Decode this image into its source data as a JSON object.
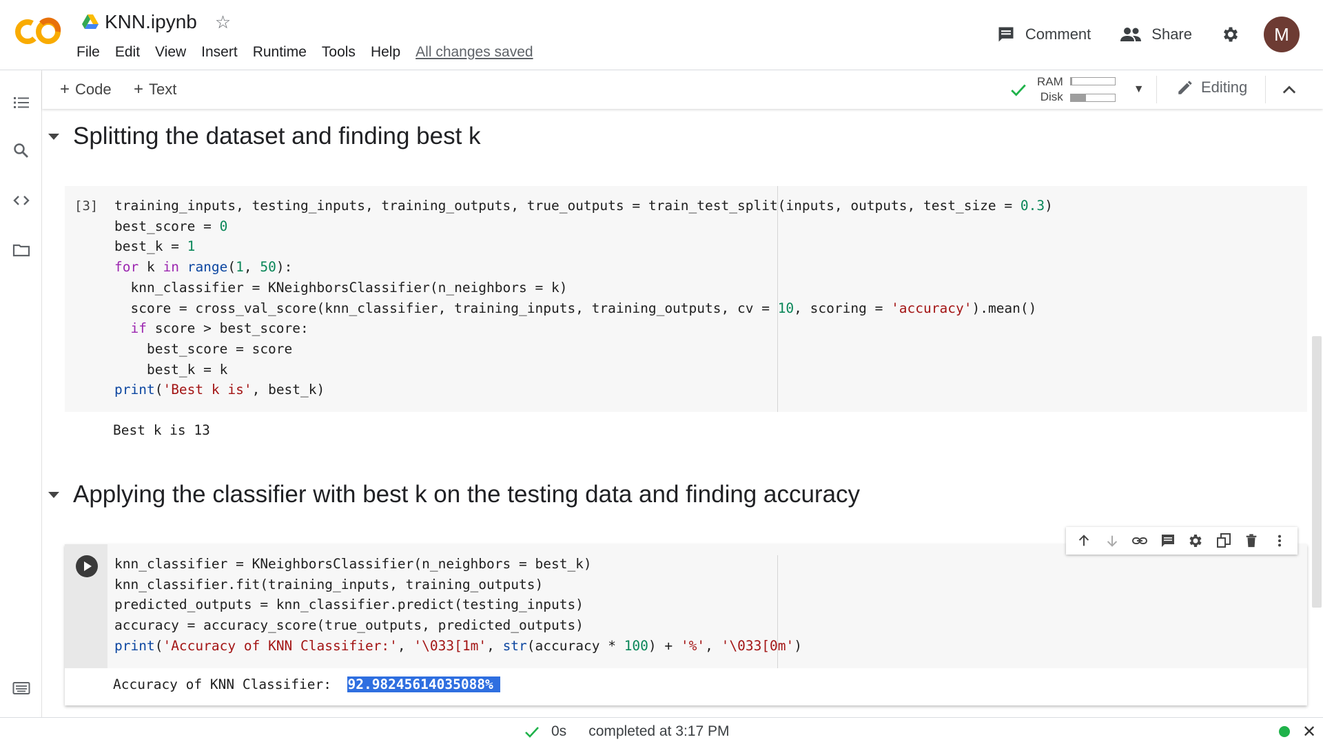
{
  "app": {
    "logo_text": "CO",
    "doc_title": "KNN.ipynb"
  },
  "menu": [
    "File",
    "Edit",
    "View",
    "Insert",
    "Runtime",
    "Tools",
    "Help"
  ],
  "save_status": "All changes saved",
  "header": {
    "comment_label": "Comment",
    "share_label": "Share",
    "avatar_initial": "M"
  },
  "toolbar": {
    "add_code_label": "Code",
    "add_text_label": "Text",
    "ram_label": "RAM",
    "disk_label": "Disk",
    "ram_usage": 0.04,
    "disk_usage": 0.35,
    "mode_label": "Editing"
  },
  "sections": [
    {
      "title": "Splitting the dataset and finding best k"
    },
    {
      "title": "Applying the classifier with best k on the testing data and finding accuracy"
    }
  ],
  "cells": [
    {
      "execution_count": "[3]",
      "code_lines": [
        "training_inputs, testing_inputs, training_outputs, true_outputs = train_test_split(inputs, outputs, test_size = 0.3)",
        "best_score = 0",
        "best_k = 1",
        "for k in range(1, 50):",
        "  knn_classifier = KNeighborsClassifier(n_neighbors = k)",
        "  score = cross_val_score(knn_classifier, training_inputs, training_outputs, cv = 10, scoring = 'accuracy').mean()",
        "  if score > best_score:",
        "    best_score = score",
        "    best_k = k",
        "print('Best k is', best_k)"
      ],
      "output": "Best k is 13"
    },
    {
      "execution_count": "",
      "code_lines": [
        "knn_classifier = KNeighborsClassifier(n_neighbors = best_k)",
        "knn_classifier.fit(training_inputs, training_outputs)",
        "predicted_outputs = knn_classifier.predict(testing_inputs)",
        "accuracy = accuracy_score(true_outputs, predicted_outputs)",
        "print('Accuracy of KNN Classifier:', '\\033[1m', str(accuracy * 100) + '%', '\\033[0m')"
      ],
      "output_label": "Accuracy of KNN Classifier:",
      "output_value": "92.98245614035088%"
    }
  ],
  "cell_toolbar_icons": [
    "arrow-up-icon",
    "arrow-down-icon",
    "link-icon",
    "comment-icon",
    "gear-icon",
    "mirror-cell-icon",
    "delete-icon",
    "more-vert-icon"
  ],
  "status": {
    "duration": "0s",
    "completed": "completed at 3:17 PM",
    "connected_color": "#1fb24a"
  }
}
